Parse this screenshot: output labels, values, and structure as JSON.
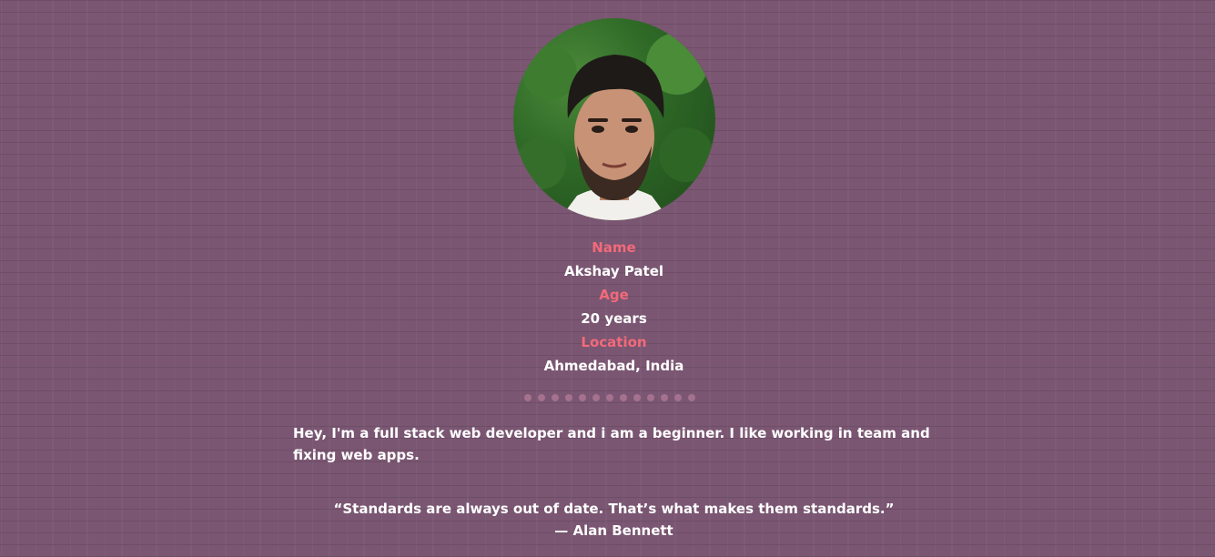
{
  "profile": {
    "photo_alt": "profile-photo",
    "name_label": "Name",
    "name_value": "Akshay Patel",
    "age_label": "Age",
    "age_value": "20 years",
    "location_label": "Location",
    "location_value": "Ahmedabad, India"
  },
  "about": {
    "text": "Hey, I'm a full stack web developer and i am a beginner. I like working in team and fixing web apps."
  },
  "quote": {
    "text": "“Standards are always out of date. That’s what makes them standards.”",
    "author": "— Alan Bennett"
  },
  "colors": {
    "background": "#7a5672",
    "label": "#f26a7a",
    "text": "#ffffff",
    "dots": "#a4728e"
  },
  "divider_dot_count": 13
}
